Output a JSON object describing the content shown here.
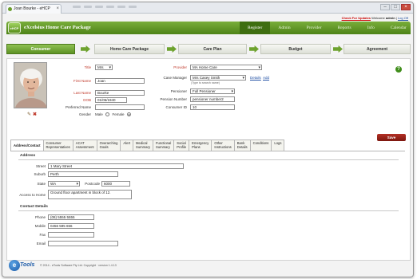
{
  "browser": {
    "tab_title": "Joan Bourke - eHCP",
    "close_glyph": "×",
    "window_buttons": [
      "–",
      "□",
      "×"
    ]
  },
  "top_links": {
    "updates": "Check For Updates",
    "welcome": "Welcome",
    "user": "admin",
    "separator": "|",
    "logout": "Log Off"
  },
  "app": {
    "logo_text": "eHCP",
    "title": "eXcelsius Home Care Package",
    "nav": [
      "Register",
      "Admin",
      "Provider",
      "Reports",
      "Info",
      "Calendar"
    ],
    "active_nav": "Register"
  },
  "workflow": [
    "Consumer",
    "Home Care Package",
    "Care Plan",
    "Budget",
    "Agreement"
  ],
  "consumer": {
    "title_label": "Title",
    "title_value": "Mrs",
    "first_name_label": "First Name",
    "first_name_value": "Joan",
    "last_name_label": "Last Name",
    "last_name_value": "Bourke",
    "dob_label": "DOB",
    "dob_value": "01/06/1940",
    "preferred_name_label": "Preferred Name",
    "preferred_name_value": "",
    "gender_label": "Gender",
    "gender_options": [
      "Male",
      "Female"
    ],
    "gender_selected": "Female",
    "provider_label": "Provider",
    "provider_value": "MA Home Care",
    "case_manager_label": "Case Manager",
    "case_manager_value": "Mrs Casey Smith",
    "case_manager_hint": "(Type to search name)",
    "details_link": "Details",
    "add_link": "Add",
    "pensioner_label": "Pensioner",
    "pensioner_value": "Full Pensioner",
    "pension_number_label": "Pension Number",
    "pension_number_value": "pensioner number2",
    "consumer_id_label": "Consumer ID",
    "consumer_id_value": "10",
    "save_label": "Save"
  },
  "tabs": [
    "Address/Contact",
    "Consumer\nRepresentatives",
    "ACAT\nAssessment",
    "Overarching\nGoals",
    "Alert",
    "Medical\nSummary",
    "Functional\nSummary",
    "Social\nProfile",
    "Emergency\nPlans",
    "Other\nInstructions",
    "Bank\nDetails",
    "Conditions",
    "Logs"
  ],
  "active_tab": "Address/Contact",
  "address": {
    "section_title": "Address",
    "street_label": "Street",
    "street_value": "1 Mary Street",
    "suburb_label": "Suburb",
    "suburb_value": "Perth",
    "state_label": "State",
    "state_value": "WA",
    "postcode_label": "Postcode",
    "postcode_value": "6000",
    "access_label": "Access to Home",
    "access_value": "Ground floor apartment in block of 12."
  },
  "contact": {
    "section_title": "Contact Details",
    "phone_label": "Phone",
    "phone_value": "(08) 5555 5555",
    "mobile_label": "Mobile",
    "mobile_value": "0456 595 656",
    "fax_label": "Fax",
    "fax_value": "",
    "email_label": "Email",
    "email_value": ""
  },
  "footer": {
    "brand_letter": "e",
    "brand_text": "Tools",
    "copyright": "© 2014 - eTools Software Pty Ltd. Copyright · version 1.4.13"
  },
  "colors": {
    "brand_green": "#5f9426",
    "required_red": "#c0392b",
    "save_red": "#9b241a",
    "link_blue": "#1f4fa3"
  },
  "icons": [
    "edit-pencil-icon",
    "delete-x-icon",
    "help-icon"
  ]
}
